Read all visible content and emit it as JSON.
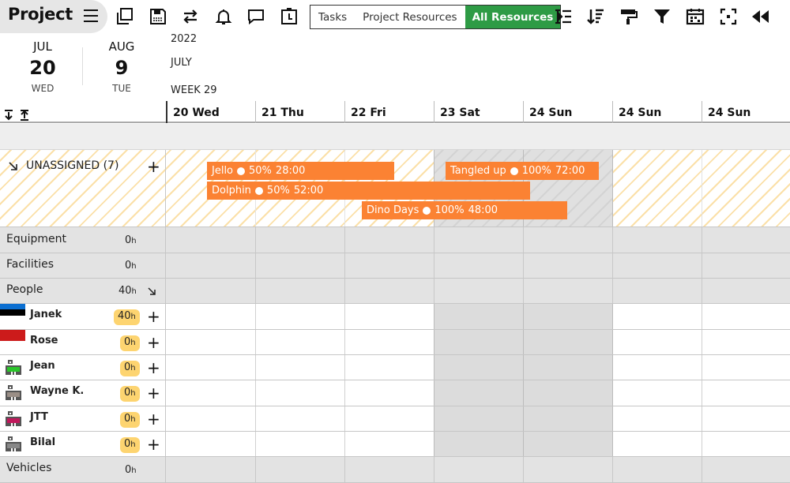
{
  "toolbar": {
    "title": "Project",
    "icons": [
      "menu-icon",
      "copy-icon",
      "save-icon",
      "swap-icon",
      "bell-icon",
      "comment-icon",
      "timer-icon",
      "outdent-icon",
      "sort-icon",
      "paint-roller-icon",
      "filter-icon",
      "calendar-icon",
      "fullscreen-icon",
      "rewind-icon"
    ],
    "views": {
      "tasks": "Tasks",
      "project_resources": "Project Resources",
      "all_resources": "All Resources"
    },
    "accent": "#2e9b45"
  },
  "date_header": {
    "start": {
      "month": "JUL",
      "day": "20",
      "weekday": "WED"
    },
    "end": {
      "month": "AUG",
      "day": "9",
      "weekday": "TUE"
    },
    "year": "2022",
    "month": "JULY",
    "week": "WEEK 29"
  },
  "days": [
    "20 Wed",
    "21 Thu",
    "22 Fri",
    "23 Sat",
    "24 Sun",
    "24 Sun",
    "24 Sun"
  ],
  "unassigned": {
    "label": "UNASSIGNED (7)",
    "tasks": [
      {
        "name": "Jello",
        "percent": "50%",
        "duration": "28:00"
      },
      {
        "name": "Tangled up",
        "percent": "100%",
        "duration": "72:00"
      },
      {
        "name": "Dolphin",
        "percent": "50%",
        "duration": "52:00"
      },
      {
        "name": "Dino Days",
        "percent": "100%",
        "duration": "48:00"
      }
    ],
    "task_color": "#fb8233"
  },
  "groups": {
    "equipment": {
      "label": "Equipment",
      "hours": "0",
      "unit": "h"
    },
    "facilities": {
      "label": "Facilities",
      "hours": "0",
      "unit": "h"
    },
    "people": {
      "label": "People",
      "hours": "40",
      "unit": "h"
    },
    "vehicles": {
      "label": "Vehicles",
      "hours": "0",
      "unit": "h"
    }
  },
  "people": [
    {
      "name": "Janek",
      "hours": "40",
      "unit": "h",
      "avatar": "flag-estonia-icon"
    },
    {
      "name": "Rose",
      "hours": "0",
      "unit": "h",
      "avatar": "flag-red-white-icon"
    },
    {
      "name": "Jean",
      "hours": "0",
      "unit": "h",
      "avatar": "robot-avatar-green-icon"
    },
    {
      "name": "Wayne K.",
      "hours": "0",
      "unit": "h",
      "avatar": "robot-avatar-gray-icon"
    },
    {
      "name": "JTT",
      "hours": "0",
      "unit": "h",
      "avatar": "robot-avatar-magenta-icon"
    },
    {
      "name": "Bilal",
      "hours": "0",
      "unit": "h",
      "avatar": "robot-avatar-darkgray-icon"
    }
  ],
  "badge_color": "#fdd470"
}
